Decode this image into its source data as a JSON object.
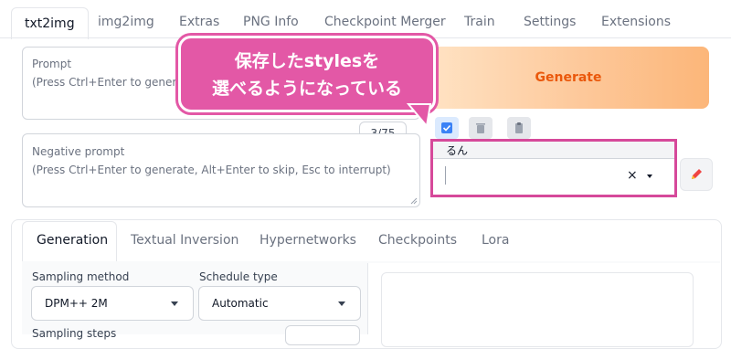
{
  "top_tabs": [
    "txt2img",
    "img2img",
    "Extras",
    "PNG Info",
    "Checkpoint Merger",
    "Train",
    "Settings",
    "Extensions"
  ],
  "prompt": {
    "label": "Prompt",
    "hint": "(Press Ctrl+Enter to generate"
  },
  "negative_prompt": {
    "label": "Negative prompt",
    "hint": "(Press Ctrl+Enter to generate, Alt+Enter to skip, Esc to interrupt)"
  },
  "generate_label": "Generate",
  "token_counter": "3/75",
  "styles": {
    "selected_tag": "るん",
    "clear_symbol": "×"
  },
  "callout": {
    "line1": "保存したstylesを",
    "line2": "選べるようになっている"
  },
  "sub_tabs": [
    "Generation",
    "Textual Inversion",
    "Hypernetworks",
    "Checkpoints",
    "Lora"
  ],
  "sampling_method": {
    "label": "Sampling method",
    "value": "DPM++ 2M"
  },
  "schedule_type": {
    "label": "Schedule type",
    "value": "Automatic"
  },
  "sampling_steps": {
    "label": "Sampling steps"
  },
  "colors": {
    "accent": "#ea580c",
    "highlight": "#d6499a",
    "callout_bg": "#e358a6"
  }
}
